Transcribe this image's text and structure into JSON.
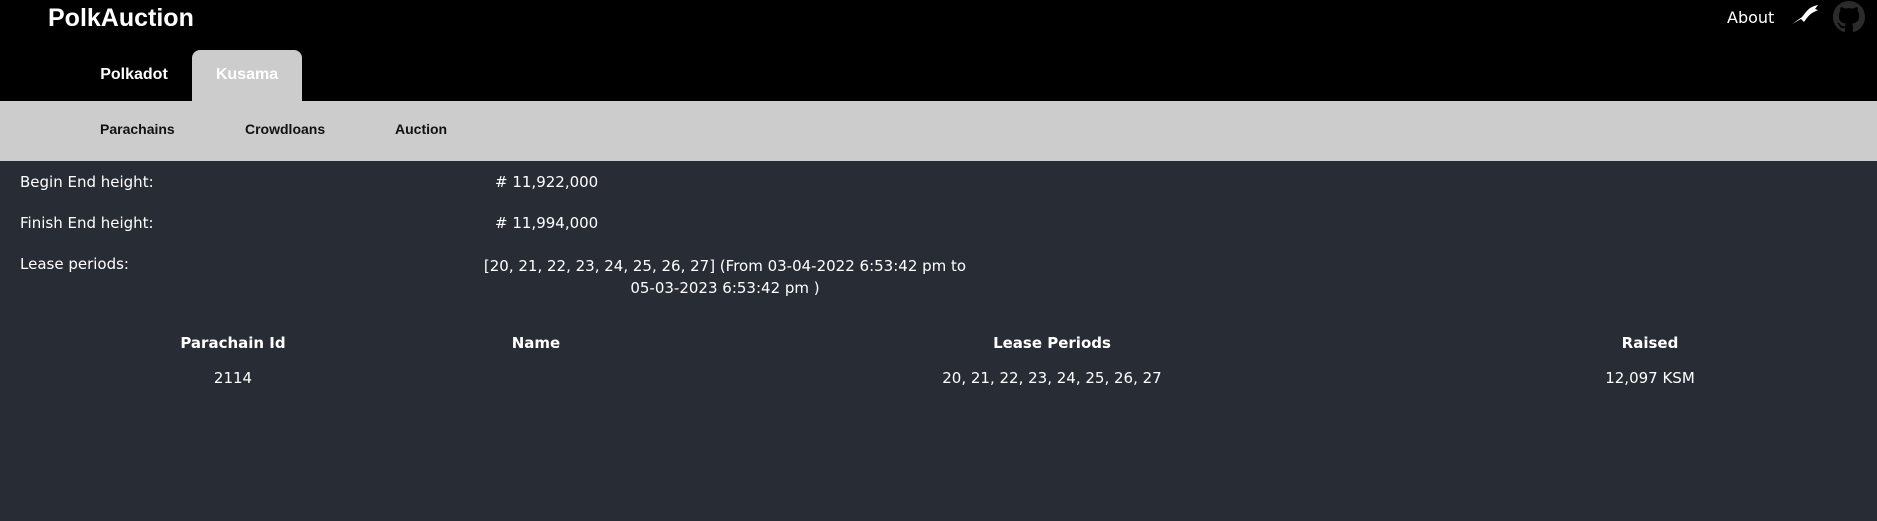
{
  "header": {
    "brand": "PolkAuction",
    "about_label": "About",
    "icons": [
      "bird-icon",
      "github-icon"
    ]
  },
  "network_tabs": [
    {
      "label": "Polkadot",
      "active": false
    },
    {
      "label": "Kusama",
      "active": true
    }
  ],
  "sub_nav": [
    {
      "label": "Parachains"
    },
    {
      "label": "Crowdloans"
    },
    {
      "label": "Auction"
    }
  ],
  "auction_info": {
    "begin_end_label": "Begin End height:",
    "begin_end_value": "# 11,922,000",
    "finish_end_label": "Finish End height:",
    "finish_end_value": "# 11,994,000",
    "lease_periods_label": "Lease periods:",
    "lease_periods_line1": "[20, 21, 22, 23, 24, 25, 26, 27] (From 03-04-2022 6:53:42 pm to",
    "lease_periods_line2": "05-03-2023 6:53:42 pm )"
  },
  "table": {
    "headers": [
      "Parachain Id",
      "Name",
      "Lease Periods",
      "Raised"
    ],
    "rows": [
      {
        "parachain_id": "2114",
        "name": "",
        "lease_periods": "20, 21, 22, 23, 24, 25, 26, 27",
        "raised": "12,097 KSM"
      }
    ]
  },
  "colors": {
    "topbar": "#000000",
    "background": "#282c34",
    "subnav": "#cccccc",
    "active_tab": "#cccccc"
  }
}
